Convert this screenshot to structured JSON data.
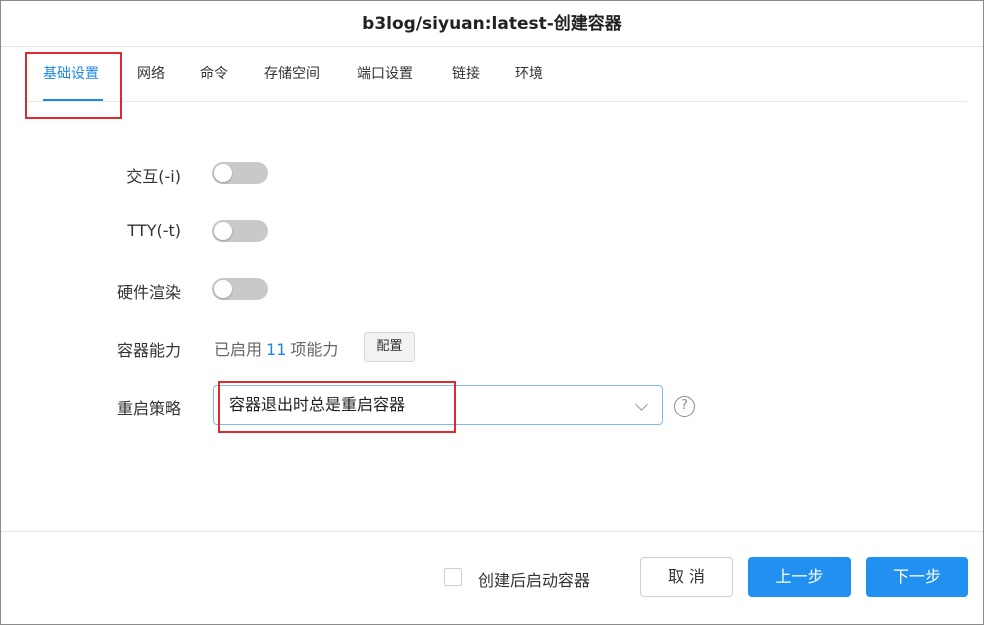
{
  "dialog": {
    "title": "b3log/siyuan:latest-创建容器"
  },
  "tabs": [
    {
      "label": "基础设置",
      "active": true
    },
    {
      "label": "网络",
      "active": false
    },
    {
      "label": "命令",
      "active": false
    },
    {
      "label": "存储空间",
      "active": false
    },
    {
      "label": "端口设置",
      "active": false
    },
    {
      "label": "链接",
      "active": false
    },
    {
      "label": "环境",
      "active": false
    }
  ],
  "form": {
    "interactive": {
      "label": "交互(-i)",
      "enabled": false
    },
    "tty": {
      "label": "TTY(-t)",
      "enabled": false
    },
    "hardware_render": {
      "label": "硬件渲染",
      "enabled": false
    },
    "capabilities": {
      "label": "容器能力",
      "prefix": "已启用",
      "count": "11",
      "suffix": "项能力",
      "config_button": "配置"
    },
    "restart_policy": {
      "label": "重启策略",
      "value": "容器退出时总是重启容器",
      "help_icon": "question-circle-icon"
    }
  },
  "footer": {
    "start_after_create": {
      "label": "创建后启动容器",
      "checked": false
    },
    "cancel": "取 消",
    "prev": "上一步",
    "next": "下一步"
  },
  "colors": {
    "accent": "#1d86e8",
    "primary_button": "#2190f0",
    "annotation": "#e02a2f",
    "toggle_off": "#c9c9c9"
  }
}
